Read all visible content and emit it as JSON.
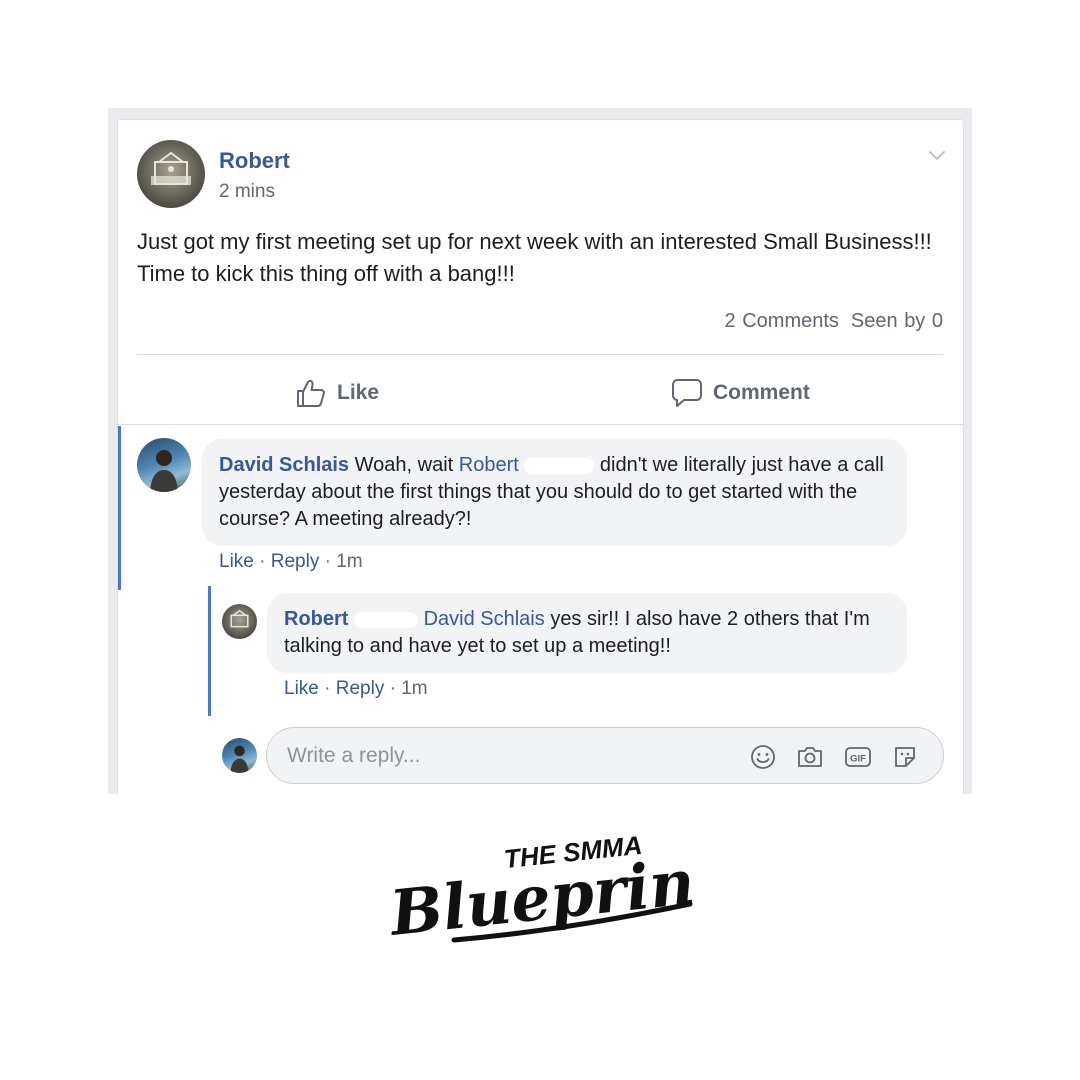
{
  "post": {
    "author": "Robert",
    "time": "2 mins",
    "text": "Just got my first meeting set up for next week with an interested Small Business!!! Time to kick this thing off with a bang!!!",
    "comments_count": "2 Comments",
    "seen_by": "Seen by 0"
  },
  "actions": {
    "like": "Like",
    "comment": "Comment"
  },
  "comments": [
    {
      "author": "David Schlais",
      "text_before": "Woah, wait",
      "mention": "Robert",
      "text_after": "didn't we literally just have a call yesterday about the first things that you should do to get started with the course? A meeting already?!",
      "like": "Like",
      "reply": "Reply",
      "dot": "·",
      "time": "1m",
      "reply_item": {
        "author": "Robert",
        "mention": "David Schlais",
        "text": "yes sir!! I also have 2 others that I'm talking to and have yet to set up a meeting!!",
        "like": "Like",
        "reply": "Reply",
        "dot": "·",
        "time": "1m"
      }
    }
  ],
  "reply_box": {
    "placeholder": "Write a reply..."
  },
  "icons": [
    "chevron-down-icon",
    "thumbs-up-icon",
    "speech-bubble-icon",
    "smiley-icon",
    "camera-icon",
    "gif-icon",
    "sticker-icon"
  ],
  "colors": {
    "link_blue": "#385898",
    "thread_bar": "#4a76d6",
    "bubble_bg": "#f2f3f5",
    "frame_bg": "#e9ebee"
  },
  "branding": {
    "line1": "THE SMMA",
    "line2": "Blueprint"
  }
}
